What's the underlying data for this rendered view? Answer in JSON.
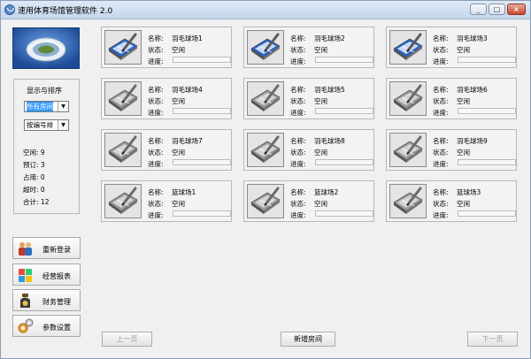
{
  "window": {
    "title": "速用体育场馆管理软件 2.0"
  },
  "sidebar": {
    "panel_title": "显示与排序",
    "filter_select": "所有房间",
    "sort_select": "按编号排",
    "stats": [
      {
        "label": "空闲:",
        "value": "9"
      },
      {
        "label": "预订:",
        "value": "3"
      },
      {
        "label": "占用:",
        "value": "0"
      },
      {
        "label": "超时:",
        "value": "0"
      },
      {
        "label": "合计:",
        "value": "12"
      }
    ],
    "buttons": [
      {
        "label": "重新登录",
        "icon": "users-icon"
      },
      {
        "label": "经营报表",
        "icon": "chart-icon"
      },
      {
        "label": "财务管理",
        "icon": "money-bag-icon"
      },
      {
        "label": "参数设置",
        "icon": "gears-icon"
      }
    ]
  },
  "fields": {
    "name": "名称:",
    "status": "状态:",
    "progress": "进度:"
  },
  "rooms": [
    {
      "name": "羽毛球场1",
      "status": "空闲",
      "booked": true
    },
    {
      "name": "羽毛球场2",
      "status": "空闲",
      "booked": true
    },
    {
      "name": "羽毛球场3",
      "status": "空闲",
      "booked": true
    },
    {
      "name": "羽毛球场4",
      "status": "空闲",
      "booked": false
    },
    {
      "name": "羽毛球场5",
      "status": "空闲",
      "booked": false
    },
    {
      "name": "羽毛球场6",
      "status": "空闲",
      "booked": false
    },
    {
      "name": "羽毛球场7",
      "status": "空闲",
      "booked": false
    },
    {
      "name": "羽毛球场8",
      "status": "空闲",
      "booked": false
    },
    {
      "name": "羽毛球场9",
      "status": "空闲",
      "booked": false
    },
    {
      "name": "篮球场1",
      "status": "空闲",
      "booked": false
    },
    {
      "name": "篮球场2",
      "status": "空闲",
      "booked": false
    },
    {
      "name": "篮球场3",
      "status": "空闲",
      "booked": false
    }
  ],
  "footer": {
    "prev": "上一页",
    "add": "新增房间",
    "next": "下一页"
  }
}
